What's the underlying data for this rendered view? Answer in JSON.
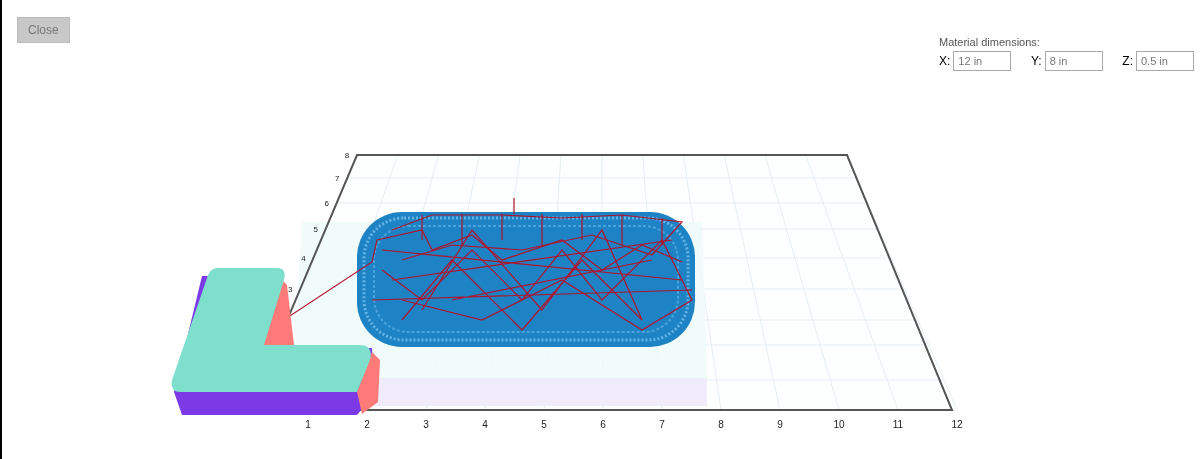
{
  "close_button": {
    "label": "Close"
  },
  "material_dimensions": {
    "title": "Material dimensions:",
    "fields": [
      {
        "label": "X:",
        "value": "12 in"
      },
      {
        "label": "Y:",
        "value": "8 in"
      },
      {
        "label": "Z:",
        "value": "0.5 in"
      }
    ]
  },
  "viewer": {
    "x_ticks": [
      "1",
      "2",
      "3",
      "4",
      "5",
      "6",
      "7",
      "8",
      "9",
      "10",
      "11",
      "12"
    ],
    "y_ticks": [
      "3",
      "4",
      "5",
      "6",
      "7",
      "8"
    ]
  }
}
